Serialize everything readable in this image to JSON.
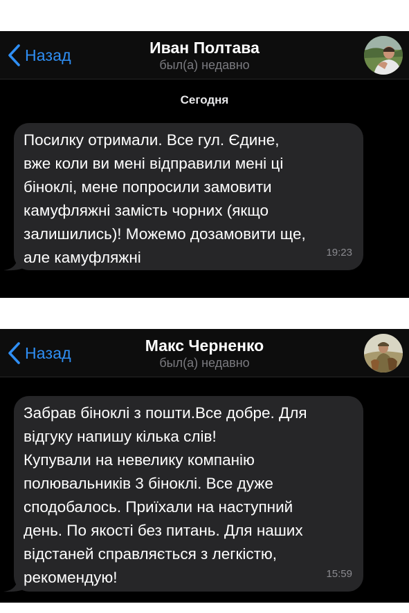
{
  "chats": [
    {
      "header": {
        "back_label": "Назад",
        "contact_name": "Иван Полтава",
        "status": "был(а) недавно"
      },
      "date_separator": "Сегодня",
      "message": {
        "lines": [
          "Посилку отримали. Все гул. Єдине,",
          "вже коли ви мені відправили мені ці",
          "біноклі, мене попросили замовити",
          "камуфляжні замість чорних (якщо",
          "залишились)! Можемо дозамовити ще,",
          "але камуфляжні"
        ],
        "time": "19:23"
      }
    },
    {
      "header": {
        "back_label": "Назад",
        "contact_name": "Макс Черненко",
        "status": "был(а) недавно"
      },
      "message": {
        "lines": [
          "Забрав біноклі з пошти.Все добре. Для",
          "відгуку напишу кілька слів!",
          "Купували на невелику компанію",
          "полювальників 3 біноклі. Все дуже",
          "сподобалось. Приїхали на наступний",
          "день. По якості без питань. Для наших",
          "відстаней справляється з легкістю,",
          "рекомендую!"
        ],
        "time": "15:59"
      }
    }
  ],
  "colors": {
    "background": "#000000",
    "header": "#0d0d0d",
    "bubble": "#262628",
    "accent": "#2f8ff5",
    "status_text": "#7b7b80"
  },
  "icons": [
    "back-chevron-icon",
    "avatar-photo"
  ]
}
